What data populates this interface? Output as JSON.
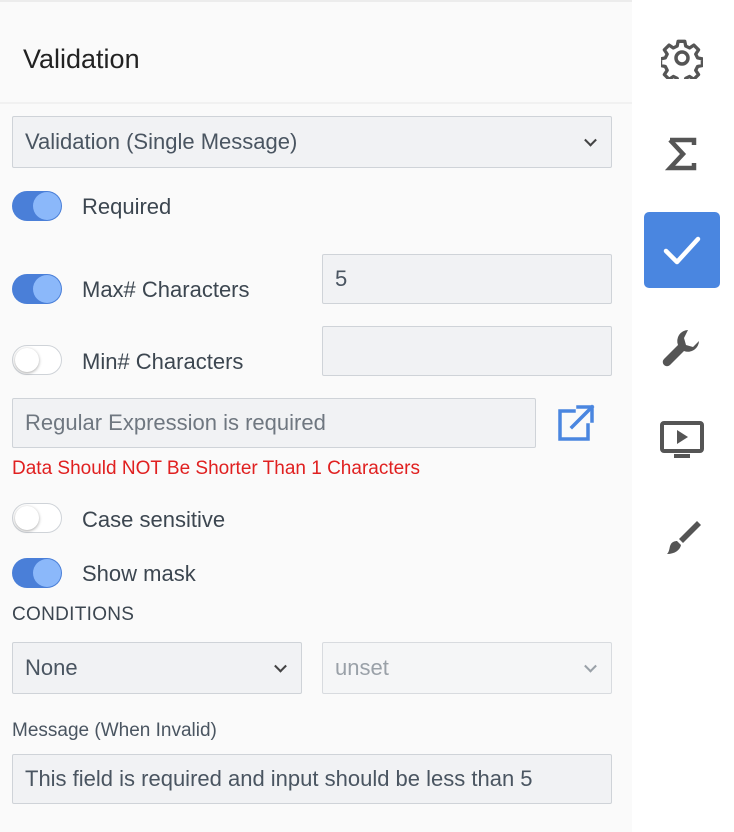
{
  "panel": {
    "title": "Validation",
    "validation_type": {
      "selected": "Validation (Single Message)"
    },
    "required": {
      "label": "Required",
      "on": true
    },
    "max_chars": {
      "label": "Max# Characters",
      "on": true,
      "value": "5"
    },
    "min_chars": {
      "label": "Min# Characters",
      "on": false,
      "value": ""
    },
    "regex": {
      "placeholder": "Regular Expression is required",
      "value": ""
    },
    "error_text": "Data Should NOT Be Shorter Than 1 Characters",
    "case_sensitive": {
      "label": "Case sensitive",
      "on": false
    },
    "show_mask": {
      "label": "Show mask",
      "on": true
    },
    "conditions": {
      "heading": "CONDITIONS",
      "condition": {
        "selected": "None"
      },
      "value": {
        "selected": "unset"
      }
    },
    "message": {
      "label": "Message (When Invalid)",
      "value": "This field is required and input should be less than 5"
    }
  },
  "sidebar": {
    "items": [
      {
        "icon": "gear-icon",
        "active": false
      },
      {
        "icon": "sigma-icon",
        "active": false
      },
      {
        "icon": "check-icon",
        "active": true
      },
      {
        "icon": "wrench-icon",
        "active": false
      },
      {
        "icon": "presentation-icon",
        "active": false
      },
      {
        "icon": "brush-icon",
        "active": false
      }
    ]
  },
  "colors": {
    "accent": "#4a86e0",
    "toggle_on": "#4a7fd8",
    "error": "#e02020",
    "icon": "#555555"
  }
}
